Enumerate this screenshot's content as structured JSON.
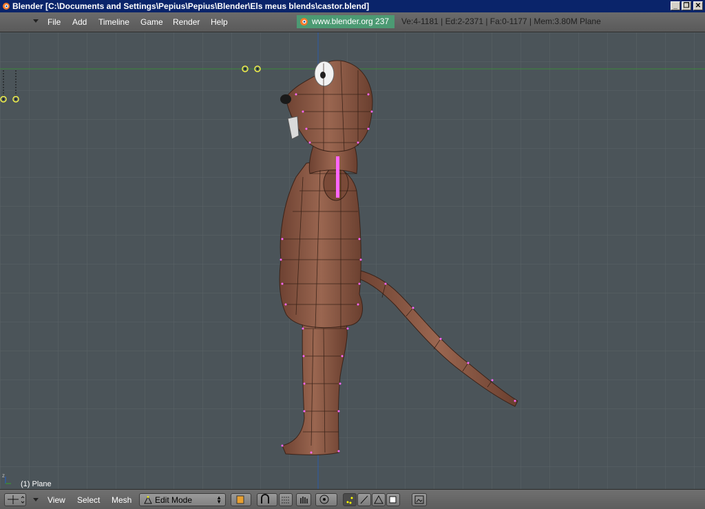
{
  "window": {
    "title": "Blender [C:\\Documents and Settings\\Pepius\\Pepius\\Blender\\Els meus blends\\castor.blend]",
    "minimize": "_",
    "maximize": "❐",
    "close": "✕"
  },
  "menubar": {
    "items": [
      "File",
      "Add",
      "Timeline",
      "Game",
      "Render",
      "Help"
    ],
    "link": "www.blender.org 237",
    "stats": "Ve:4-1181 | Ed:2-2371 | Fa:0-1177 | Mem:3.80M Plane"
  },
  "viewport": {
    "object_label": "(1) Plane",
    "colors": {
      "background": "#4b5459",
      "grid": "#5b6368",
      "mesh": "#8a5a44",
      "selected_vertex": "#ff66ff"
    }
  },
  "bottombar": {
    "menus": [
      "View",
      "Select",
      "Mesh"
    ],
    "mode": "Edit Mode",
    "icons": [
      "view-type-icon",
      "object-mode-icon",
      "pivot-icon",
      "transform-manipulator-icon",
      "grab-icon",
      "proportional-edit-icon",
      "vertex-select-icon",
      "edge-select-icon",
      "face-select-icon",
      "occlude-icon",
      "render-preview-icon"
    ]
  }
}
